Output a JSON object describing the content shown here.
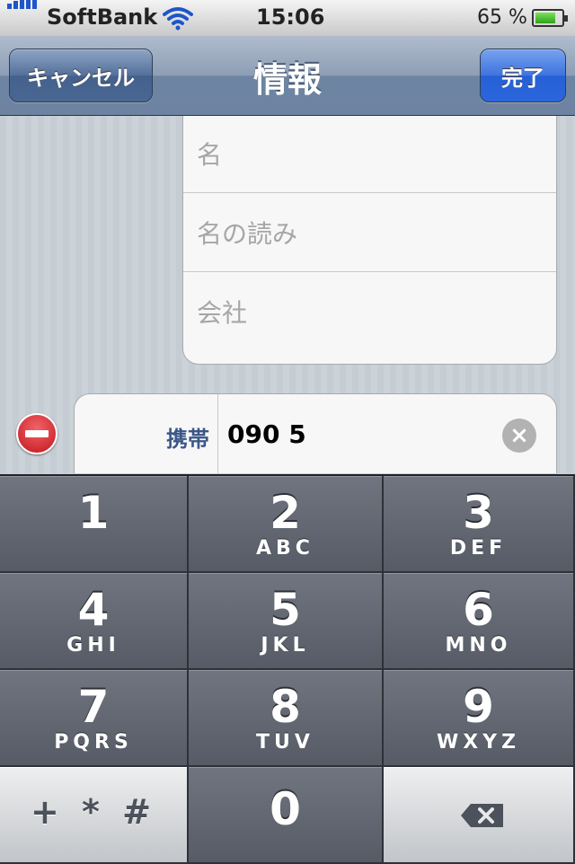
{
  "status_bar": {
    "carrier": "SoftBank",
    "time": "15:06",
    "battery": "65 %",
    "icons": [
      "signal-bars-icon",
      "wifi-icon",
      "battery-icon"
    ]
  },
  "nav": {
    "title": "情報",
    "cancel_label": "キャンセル",
    "done_label": "完了"
  },
  "form": {
    "fields": [
      {
        "placeholder": "名"
      },
      {
        "placeholder": "名の読み"
      },
      {
        "placeholder": "会社"
      }
    ],
    "phone": {
      "label": "携帯",
      "value": "090 5"
    }
  },
  "keypad": {
    "keys": [
      {
        "digit": "1",
        "letters": ""
      },
      {
        "digit": "2",
        "letters": "ABC"
      },
      {
        "digit": "3",
        "letters": "DEF"
      },
      {
        "digit": "4",
        "letters": "GHI"
      },
      {
        "digit": "5",
        "letters": "JKL"
      },
      {
        "digit": "6",
        "letters": "MNO"
      },
      {
        "digit": "7",
        "letters": "PQRS"
      },
      {
        "digit": "8",
        "letters": "TUV"
      },
      {
        "digit": "9",
        "letters": "WXYZ"
      }
    ],
    "symbols": "+ * #",
    "zero": "0"
  },
  "colors": {
    "nav_bar": "#6d84a2",
    "done_button": "#2660d6",
    "phone_label": "#3c5688",
    "delete_icon": "#c4141c"
  }
}
